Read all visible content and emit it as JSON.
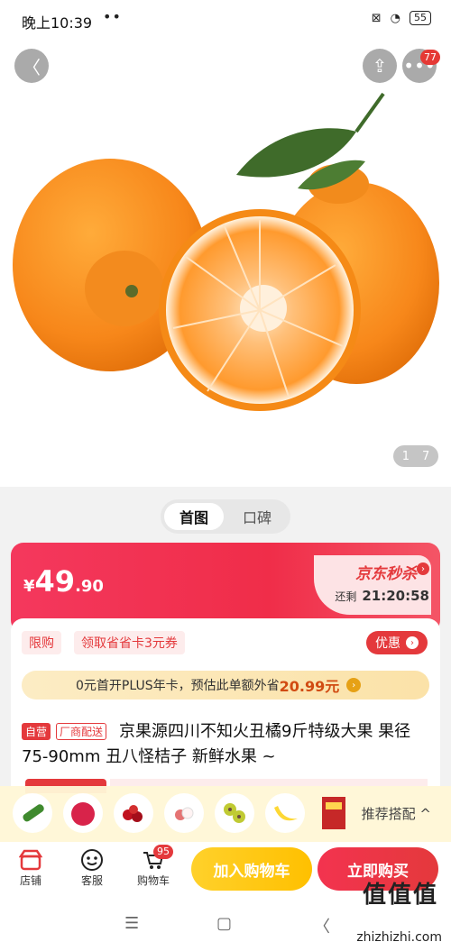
{
  "status_bar": {
    "time": "晚上10:39",
    "dots": "••",
    "battery": "55"
  },
  "header": {
    "more_badge": "77"
  },
  "gallery": {
    "current": "1",
    "total": "7"
  },
  "tabs": [
    "首图",
    "口碑"
  ],
  "price": {
    "currency": "¥",
    "integer": "49",
    "decimal": ".90"
  },
  "flash_sale": {
    "title": "京东秒杀",
    "remaining_label": "还剩",
    "countdown": "21:20:58"
  },
  "tags": {
    "limit": "限购",
    "coupon": "领取省省卡3元券",
    "discount": "优惠"
  },
  "plus_banner": {
    "text": "0元首开PLUS年卡，预估此单额外省",
    "amount": "20.99元"
  },
  "product": {
    "self_run": "自营",
    "ship": "厂商配送",
    "title": "京果源四川不知火丑橘9斤特级大果 果径75-90mm 丑八怪桔子 新鲜水果 ~"
  },
  "recommend": {
    "label": "推荐搭配 ^"
  },
  "actions": {
    "store": "店铺",
    "service": "客服",
    "cart": "购物车",
    "cart_badge": "95",
    "add_to_cart": "加入购物车",
    "buy_now": "立即购买"
  },
  "system_nav": {
    "menu": "☰",
    "home": "▢",
    "back": "〈"
  },
  "watermark": {
    "logo": "值值值",
    "url": "zhizhizhi.com"
  }
}
